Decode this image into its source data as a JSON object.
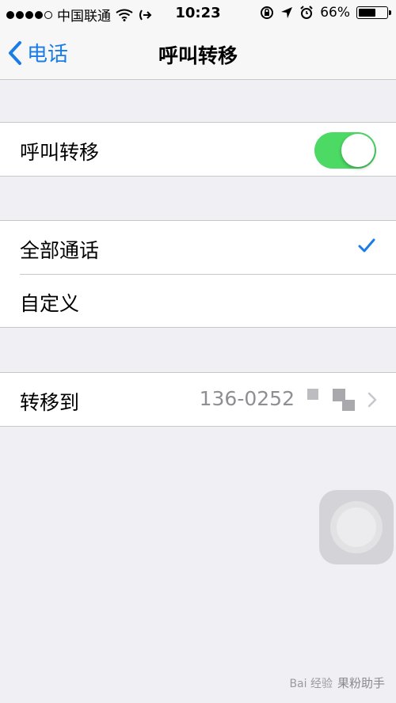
{
  "status_bar": {
    "carrier": "中国联通",
    "time": "10:23",
    "battery": "66%",
    "battery_level": 0.66,
    "signal_bars": 4,
    "signal_max": 5
  },
  "nav": {
    "back_label": "电话",
    "title": "呼叫转移"
  },
  "sections": {
    "toggle_row": {
      "label": "呼叫转移",
      "enabled": true
    },
    "options": [
      {
        "label": "全部通话",
        "selected": true
      },
      {
        "label": "自定义",
        "selected": false
      }
    ],
    "forward_to": {
      "label": "转移到",
      "value": "136-0252"
    }
  },
  "watermark": {
    "logo": "Bai 经验",
    "text": "果粉助手"
  },
  "colors": {
    "accent": "#1a7ce8",
    "toggle_on": "#4cd964",
    "background": "#efeff4",
    "separator": "#c8c7cc",
    "secondary_text": "#8e8e93"
  },
  "icons": {
    "wifi": "wifi-icon",
    "call_forward": "call-forward-icon",
    "lock_rotation": "rotation-lock-icon",
    "location": "location-arrow-icon",
    "alarm": "alarm-icon",
    "back": "chevron-left-icon",
    "check": "checkmark-icon",
    "disclosure": "chevron-right-icon"
  }
}
